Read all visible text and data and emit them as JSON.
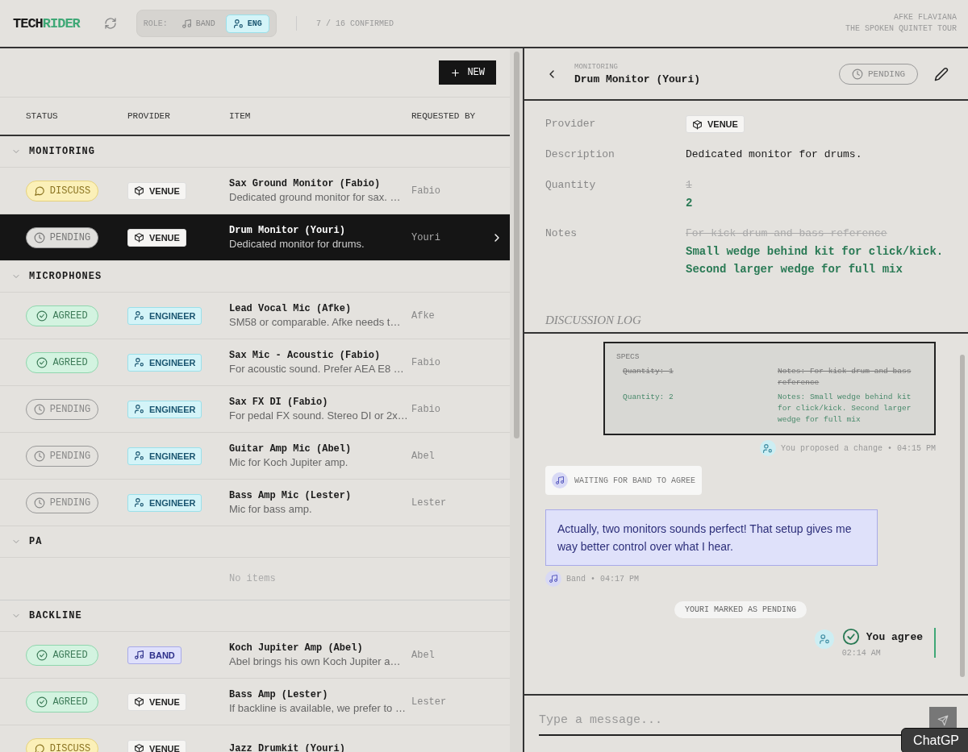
{
  "header": {
    "logo": {
      "dark": "TECH",
      "accent": "RIDER"
    },
    "role_label": "ROLE:",
    "roles": [
      {
        "kind": "band",
        "label": "BAND",
        "selected": false
      },
      {
        "kind": "engineer",
        "label": "ENG",
        "selected": true
      }
    ],
    "confirmed": "7 / 16 CONFIRMED",
    "user": "AFKE FLAVIANA",
    "tour": "THE SPOKEN QUINTET TOUR"
  },
  "list": {
    "new_button": "NEW",
    "columns": [
      "STATUS",
      "PROVIDER",
      "ITEM",
      "REQUESTED BY"
    ],
    "groups": [
      {
        "name": "MONITORING",
        "expanded": true,
        "items": [
          {
            "status": {
              "kind": "discuss",
              "label": "DISCUSS"
            },
            "provider": {
              "kind": "venue",
              "label": "VENUE"
            },
            "title": "Sax Ground Monitor (Fabio)",
            "description": "Dedicated ground monitor for sax. …",
            "requested_by": "Fabio",
            "selected": false
          },
          {
            "status": {
              "kind": "pending",
              "label": "PENDING"
            },
            "provider": {
              "kind": "venue",
              "label": "VENUE"
            },
            "title": "Drum Monitor (Youri)",
            "description": "Dedicated monitor for drums.",
            "requested_by": "Youri",
            "selected": true
          }
        ]
      },
      {
        "name": "MICROPHONES",
        "expanded": true,
        "items": [
          {
            "status": {
              "kind": "agreed",
              "label": "AGREED"
            },
            "provider": {
              "kind": "engineer",
              "label": "ENGINEER"
            },
            "title": "Lead Vocal Mic (Afke)",
            "description": "SM58 or comparable. Afke needs t…",
            "requested_by": "Afke",
            "selected": false
          },
          {
            "status": {
              "kind": "agreed",
              "label": "AGREED"
            },
            "provider": {
              "kind": "engineer",
              "label": "ENGINEER"
            },
            "title": "Sax Mic - Acoustic (Fabio)",
            "description": "For acoustic sound. Prefer AEA E8 …",
            "requested_by": "Fabio",
            "selected": false
          },
          {
            "status": {
              "kind": "pending",
              "label": "PENDING"
            },
            "provider": {
              "kind": "engineer",
              "label": "ENGINEER"
            },
            "title": "Sax FX DI (Fabio)",
            "description": "For pedal FX sound. Stereo DI or 2x…",
            "requested_by": "Fabio",
            "selected": false
          },
          {
            "status": {
              "kind": "pending",
              "label": "PENDING"
            },
            "provider": {
              "kind": "engineer",
              "label": "ENGINEER"
            },
            "title": "Guitar Amp Mic (Abel)",
            "description": "Mic for Koch Jupiter amp.",
            "requested_by": "Abel",
            "selected": false
          },
          {
            "status": {
              "kind": "pending",
              "label": "PENDING"
            },
            "provider": {
              "kind": "engineer",
              "label": "ENGINEER"
            },
            "title": "Bass Amp Mic (Lester)",
            "description": "Mic for bass amp.",
            "requested_by": "Lester",
            "selected": false
          }
        ]
      },
      {
        "name": "PA",
        "expanded": true,
        "empty_text": "No items"
      },
      {
        "name": "BACKLINE",
        "expanded": true,
        "items": [
          {
            "status": {
              "kind": "agreed",
              "label": "AGREED"
            },
            "provider": {
              "kind": "band",
              "label": "BAND"
            },
            "title": "Koch Jupiter Amp (Abel)",
            "description": "Abel brings his own Koch Jupiter a…",
            "requested_by": "Abel",
            "selected": false
          },
          {
            "status": {
              "kind": "agreed",
              "label": "AGREED"
            },
            "provider": {
              "kind": "venue",
              "label": "VENUE"
            },
            "title": "Bass Amp (Lester)",
            "description": "If backline is available, we prefer to …",
            "requested_by": "Lester",
            "selected": false
          },
          {
            "status": {
              "kind": "discuss",
              "label": "DISCUSS"
            },
            "provider": {
              "kind": "venue",
              "label": "VENUE"
            },
            "title": "Jazz Drumkit (Youri)",
            "selected": false
          }
        ]
      }
    ]
  },
  "detail": {
    "breadcrumb": "MONITORING",
    "title": "Drum Monitor (Youri)",
    "status": {
      "kind": "pending",
      "label": "PENDING"
    },
    "fields": [
      {
        "kind": "provider",
        "label": "Provider",
        "provider": {
          "kind": "venue",
          "label": "VENUE"
        }
      },
      {
        "kind": "text",
        "label": "Description",
        "value": "Dedicated monitor for drums."
      },
      {
        "kind": "change",
        "label": "Quantity",
        "old": "1",
        "new": "2"
      },
      {
        "kind": "change",
        "label": "Notes",
        "old": "For kick drum and bass reference",
        "new": "Small wedge behind kit for click/kick. Second larger wedge for full mix"
      }
    ],
    "log_title": "DISCUSSION LOG",
    "log": [
      {
        "kind": "specs",
        "title": "SPECS",
        "old_quantity": "Quantity: 1",
        "old_notes": "Notes: For kick drum and bass reference",
        "new_quantity": "Quantity: 2",
        "new_notes": "Notes: Small wedge behind kit for click/kick. Second larger wedge for full mix",
        "footer": "You proposed a change • 04:15 PM"
      },
      {
        "kind": "waiting",
        "text": "WAITING FOR BAND TO AGREE"
      },
      {
        "kind": "message",
        "text": "Actually, two monitors sounds perfect! That setup gives me way better control over what I hear.",
        "meta": "Band • 04:17 PM"
      },
      {
        "kind": "event",
        "text": "YOURI MARKED AS PENDING"
      },
      {
        "kind": "agree",
        "text": "You agree",
        "time": "02:14 AM"
      }
    ],
    "composer": {
      "placeholder": "Type a message..."
    },
    "tooltip": "ChatGP"
  }
}
